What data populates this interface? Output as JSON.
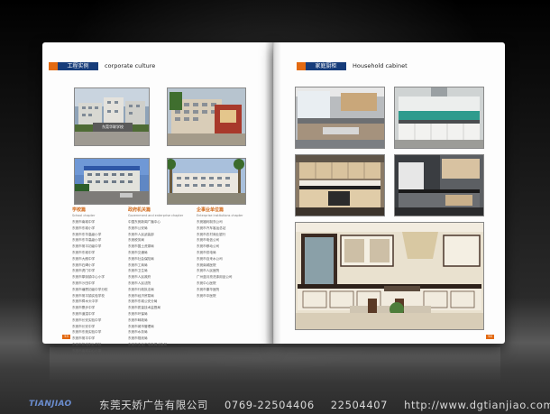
{
  "left_page": {
    "header": {
      "zh": "工程实例",
      "en": "corporate culture"
    },
    "photo_caption": "东莞华联学校",
    "columns": [
      {
        "title": "学校篇",
        "subtitle": "School chapter",
        "items": [
          "东莞市南城中学",
          "东莞市东城小学",
          "东莞市东华高级小学",
          "东莞市东华高级小学",
          "东莞市常平初级中学",
          "东莞市东城中学",
          "东莞市大朗中学",
          "东莞市石碣小学",
          "东莞市虎门中学",
          "东莞市厚街镇中心小学",
          "东莞市沙田中学",
          "东莞市塘厦初级中学分校",
          "东莞市常平镇实验学校",
          "东莞市樟木头中学",
          "东莞市寮步中学",
          "东莞市道滘中学",
          "东莞市长安实验中学",
          "东莞市长安中学",
          "东莞市东莞实验中学",
          "东莞市常平中学",
          "东莞市机电职业学校",
          "东莞市南城中心小学"
        ]
      },
      {
        "title": "政府机关篇",
        "subtitle": "Government and enterprise chapter",
        "items": [
          "中国东莞新闻广播中心",
          "东莞市公安局",
          "东莞市人民武装部",
          "东莞税务局",
          "东莞市国土资源局",
          "东莞市交通局",
          "东莞市社会保险局",
          "东莞市工商局",
          "东莞市卫生局",
          "东莞市人民政府",
          "东莞市人民法院",
          "东莞市行政执法局",
          "东莞市经济贸易局",
          "东莞市东城公安分局",
          "东莞市质量技术监督局",
          "东莞市环保局",
          "东莞市邮政局",
          "东莞市城市管理局",
          "东莞市水务局",
          "东莞市规划局",
          "东莞市文化广电新闻出版局"
        ]
      },
      {
        "title": "企事业单位篇",
        "subtitle": "Enterprise institutions chapter",
        "items": [
          "东莞福利制衣公司",
          "东莞市汽车客运总站",
          "东莞市农村商业银行",
          "东莞市电信公司",
          "东莞市移动公司",
          "东莞市供电局",
          "东莞市自来水公司",
          "东莞南城医院",
          "东莞市人民医院",
          "广州蓝月亮洗涤用品公司",
          "东莞中心医院",
          "东莞市康华医院",
          "东莞市中医院"
        ]
      }
    ],
    "page_number": "53"
  },
  "right_page": {
    "header": {
      "zh": "家庭厨柜",
      "en": "Household cabinet"
    },
    "page_number": "54"
  },
  "footer": {
    "logo": "TIANJIAO",
    "company": "东莞天娇广告有限公司",
    "phone1": "0769-22504406",
    "phone2": "22504407",
    "url": "http://www.dgtianjiao.com"
  },
  "colors": {
    "accent": "#e36a12",
    "brand_blue": "#163c7a"
  }
}
